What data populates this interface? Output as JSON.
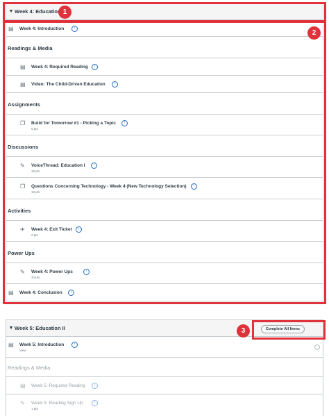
{
  "module1": {
    "title": "Week 4: Education I",
    "items": [
      {
        "kind": "item",
        "icon": "page-icon",
        "glyph": "▤",
        "title": "Week 4: Introduction",
        "indent": 0
      },
      {
        "kind": "header",
        "title": "Readings & Media"
      },
      {
        "kind": "item",
        "icon": "page-icon",
        "glyph": "▤",
        "title": "Week 4: Required Reading",
        "indent": 1
      },
      {
        "kind": "item",
        "icon": "page-icon",
        "glyph": "▤",
        "title": "Video: The Child-Driven Education",
        "indent": 1
      },
      {
        "kind": "header",
        "title": "Assignments"
      },
      {
        "kind": "item",
        "icon": "discussion-icon",
        "glyph": "❐",
        "title": "Build for Tomorrow #1 - Picking a Topic",
        "pts": "5 pts",
        "indent": 1
      },
      {
        "kind": "header",
        "title": "Discussions"
      },
      {
        "kind": "item",
        "icon": "assignment-icon",
        "glyph": "✎",
        "title": "VoiceThread: Education I",
        "pts": "10 pts",
        "indent": 1
      },
      {
        "kind": "item",
        "icon": "discussion-icon",
        "glyph": "❐",
        "title": "Questions Concerning Technology - Week 4 (New Technology Selection)",
        "pts": "10 pts",
        "indent": 1
      },
      {
        "kind": "header",
        "title": "Activities"
      },
      {
        "kind": "item",
        "icon": "quiz-rocket-icon",
        "glyph": "✈",
        "title": "Week 4: Exit Ticket",
        "pts": "2 pts",
        "indent": 1
      },
      {
        "kind": "header",
        "title": "Power Ups"
      },
      {
        "kind": "item",
        "icon": "assignment-icon",
        "glyph": "✎",
        "title": "Week 4: Power Ups",
        "pts": "20 pts",
        "indent": 1
      },
      {
        "kind": "item",
        "icon": "page-icon",
        "glyph": "▤",
        "title": "Week 4: Conclusion",
        "indent": 0
      }
    ]
  },
  "module2": {
    "title": "Week 5: Education II",
    "complete_button": "Complete All Items",
    "items": [
      {
        "kind": "item",
        "icon": "page-icon",
        "glyph": "▤",
        "title": "Week 5: Introduction",
        "sub": "View",
        "indent": 0,
        "radio": true
      },
      {
        "kind": "header",
        "title": "Readings & Media",
        "muted": true
      },
      {
        "kind": "item",
        "icon": "page-icon",
        "glyph": "▤",
        "title": "Week 5: Required Reading",
        "indent": 1,
        "muted": true
      },
      {
        "kind": "item",
        "icon": "assignment-icon",
        "glyph": "✎",
        "title": "Week 5: Reading Sign Up",
        "pts": "1 pts",
        "indent": 1,
        "muted": true
      }
    ]
  },
  "mastery_glyph": "↑",
  "callouts": [
    "1",
    "2",
    "3"
  ],
  "colors": {
    "highlight": "#e0323a",
    "accent": "#1e6bbf",
    "border": "#c7cdd1"
  }
}
